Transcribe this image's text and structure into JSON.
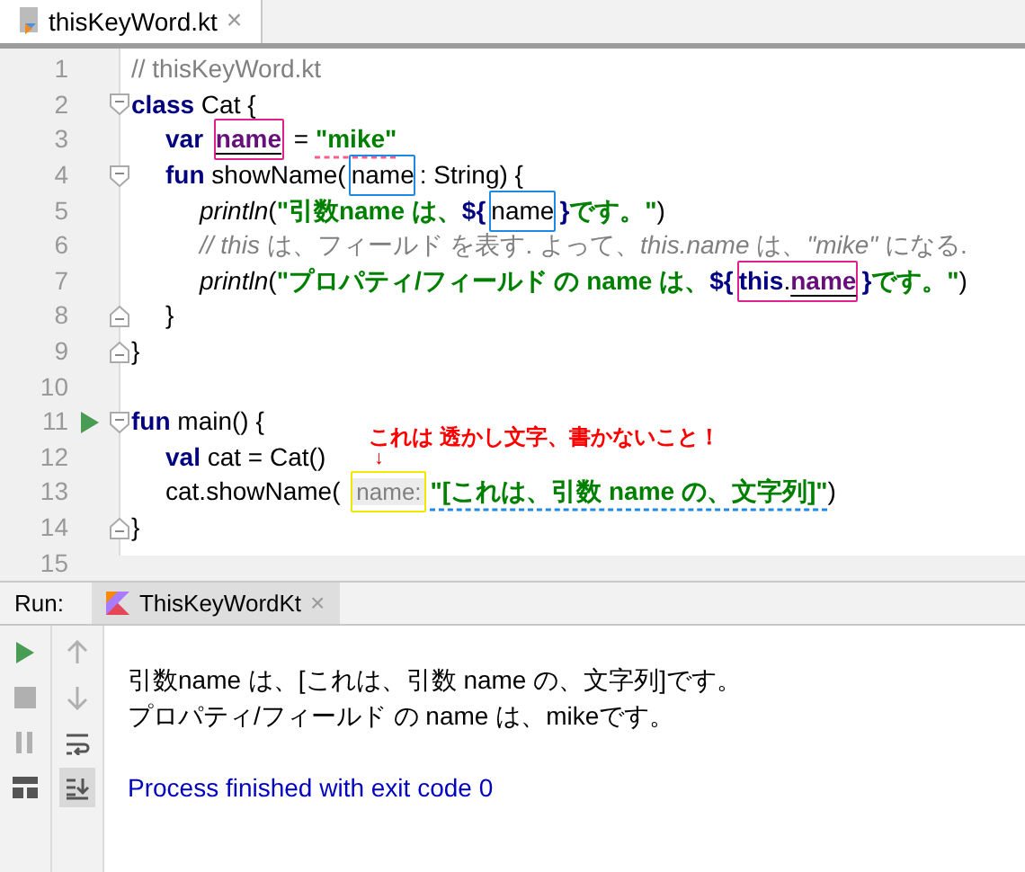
{
  "editor_tabs": [
    {
      "label": "thisKeyWord.kt",
      "selected": true,
      "close": "×"
    }
  ],
  "code_lines": [
    {
      "number": "1",
      "run": false,
      "tokens": [
        {
          "kind": "comment",
          "text": "// thisKeyWord.kt"
        }
      ]
    },
    {
      "number": "2",
      "fold_marker": {
        "kind": "start"
      },
      "run": false,
      "tokens": [
        {
          "kind": "keyword",
          "text": "class"
        },
        {
          "kind": "plain",
          "text": " Cat {"
        }
      ],
      "children": [
        {
          "number": "3",
          "run": false,
          "tokens": [
            {
              "kind": "keyword",
              "text": "var "
            },
            {
              "kind": "boxed",
              "color": "#e0208c",
              "tokens": [
                {
                  "kind": "property",
                  "text": "name"
                }
              ]
            },
            {
              "kind": "plain",
              "text": " = "
            },
            {
              "kind": "string",
              "text": "\"mike\"",
              "color": "#ff5c8d"
            }
          ]
        },
        {
          "number": "4",
          "fold_marker": {
            "kind": "start"
          },
          "run": false,
          "tokens": [
            {
              "kind": "keyword",
              "text": "fun"
            },
            {
              "kind": "plain",
              "text": " showName("
            },
            {
              "kind": "boxed",
              "color": "#1e88e5",
              "tokens": [
                {
                  "kind": "plain",
                  "text": "name"
                }
              ]
            },
            {
              "kind": "plain",
              "text": ": String) {"
            }
          ],
          "children": [
            {
              "number": "5",
              "run": false,
              "tokens": [
                {
                  "kind": "call",
                  "text": "println"
                },
                {
                  "kind": "plain",
                  "text": "("
                },
                {
                  "kind": "string",
                  "text": "\"引数name は、"
                },
                {
                  "kind": "interp",
                  "text": "${"
                },
                {
                  "kind": "boxed",
                  "color": "#1e88e5",
                  "tokens": [
                    {
                      "kind": "plain",
                      "text": "name"
                    }
                  ]
                },
                {
                  "kind": "interp",
                  "text": "}"
                },
                {
                  "kind": "string",
                  "text": "です。\""
                },
                {
                  "kind": "plain",
                  "text": ")"
                }
              ]
            },
            {
              "number": "6",
              "run": false,
              "tokens": [
                {
                  "kind": "comment",
                  "text": "*// this* は、フィールド を表す. よって、*this.name* は、*\"mike\"* になる."
                }
              ]
            },
            {
              "number": "7",
              "run": false,
              "tokens": [
                {
                  "kind": "call",
                  "text": "println"
                },
                {
                  "kind": "plain",
                  "text": "("
                },
                {
                  "kind": "string",
                  "text": "\"プロパティ/フィールド の name は、"
                },
                {
                  "kind": "interp",
                  "text": "${"
                },
                {
                  "kind": "boxed",
                  "color": "#e0208c",
                  "tokens": [
                    {
                      "kind": "interp",
                      "text": "this"
                    },
                    {
                      "kind": "plain",
                      "text": "."
                    },
                    {
                      "kind": "property",
                      "text": "name"
                    }
                  ]
                },
                {
                  "kind": "interp",
                  "text": "}"
                },
                {
                  "kind": "string",
                  "text": "です。\""
                },
                {
                  "kind": "plain",
                  "text": ")"
                }
              ]
            }
          ]
        },
        {
          "number": "8",
          "fold_marker": {
            "kind": "end"
          },
          "run": false,
          "tokens": [
            {
              "kind": "plain",
              "text": "}"
            }
          ]
        }
      ]
    },
    {
      "number": "9",
      "fold_marker": {
        "kind": "end"
      },
      "run": false,
      "tokens": [
        {
          "kind": "plain",
          "text": "}"
        }
      ]
    },
    {
      "number": "10",
      "run": false
    },
    {
      "number": "11",
      "fold_marker": {
        "kind": "start"
      },
      "run": true,
      "tokens": [
        {
          "kind": "keyword",
          "text": "fun"
        },
        {
          "kind": "plain",
          "text": " main() {"
        }
      ],
      "children": [
        {
          "number": "12",
          "run": false,
          "tokens": [
            {
              "kind": "keyword",
              "text": "val"
            },
            {
              "kind": "plain",
              "text": " cat = Cat()"
            }
          ]
        },
        {
          "number": "13",
          "run": false,
          "tokens": [
            {
              "kind": "plain",
              "text": "cat.showName( "
            },
            {
              "kind": "boxed",
              "color": "#f5e600",
              "tokens": [
                {
                  "kind": "hint",
                  "text": "name:"
                }
              ]
            },
            {
              "kind": "string",
              "text": "\"[これは、引数 name の、文字列]\"",
              "color": "#1e88e5"
            },
            {
              "kind": "plain",
              "text": ")"
            }
          ]
        }
      ]
    },
    {
      "number": "14",
      "fold_marker": {
        "kind": "end"
      },
      "run": false,
      "tokens": [
        {
          "kind": "plain",
          "text": "}"
        }
      ]
    },
    {
      "number": "15",
      "run": false
    }
  ],
  "annotation": {
    "text": "これは 透かし文字、書かないこと！",
    "arrow": "↓"
  },
  "run_panel": {
    "label": "Run:",
    "tabs": [
      {
        "label": "ThisKeyWordKt",
        "selected": true,
        "close": "×"
      }
    ],
    "toolbar_columns": [
      [
        {
          "kind": "play",
          "disabled": false,
          "selected": false
        },
        {
          "kind": "stop",
          "disabled": true,
          "selected": false
        },
        {
          "kind": "pause",
          "disabled": true,
          "selected": false
        },
        {
          "kind": "layout",
          "disabled": false,
          "selected": false
        }
      ],
      [
        {
          "kind": "up",
          "disabled": true,
          "selected": false
        },
        {
          "kind": "down",
          "disabled": true,
          "selected": false
        },
        {
          "kind": "wrap",
          "disabled": false,
          "selected": false
        },
        {
          "kind": "scroll-end",
          "disabled": false,
          "selected": true
        }
      ]
    ],
    "output": [
      {
        "kind": "stdout",
        "text": "引数name は、[これは、引数 name の、文字列]です。"
      },
      {
        "kind": "stdout",
        "text": "プロパティ/フィールド の name は、mikeです。"
      },
      {
        "kind": "blank"
      },
      {
        "kind": "system",
        "text": "Process finished with exit code 0"
      }
    ]
  }
}
